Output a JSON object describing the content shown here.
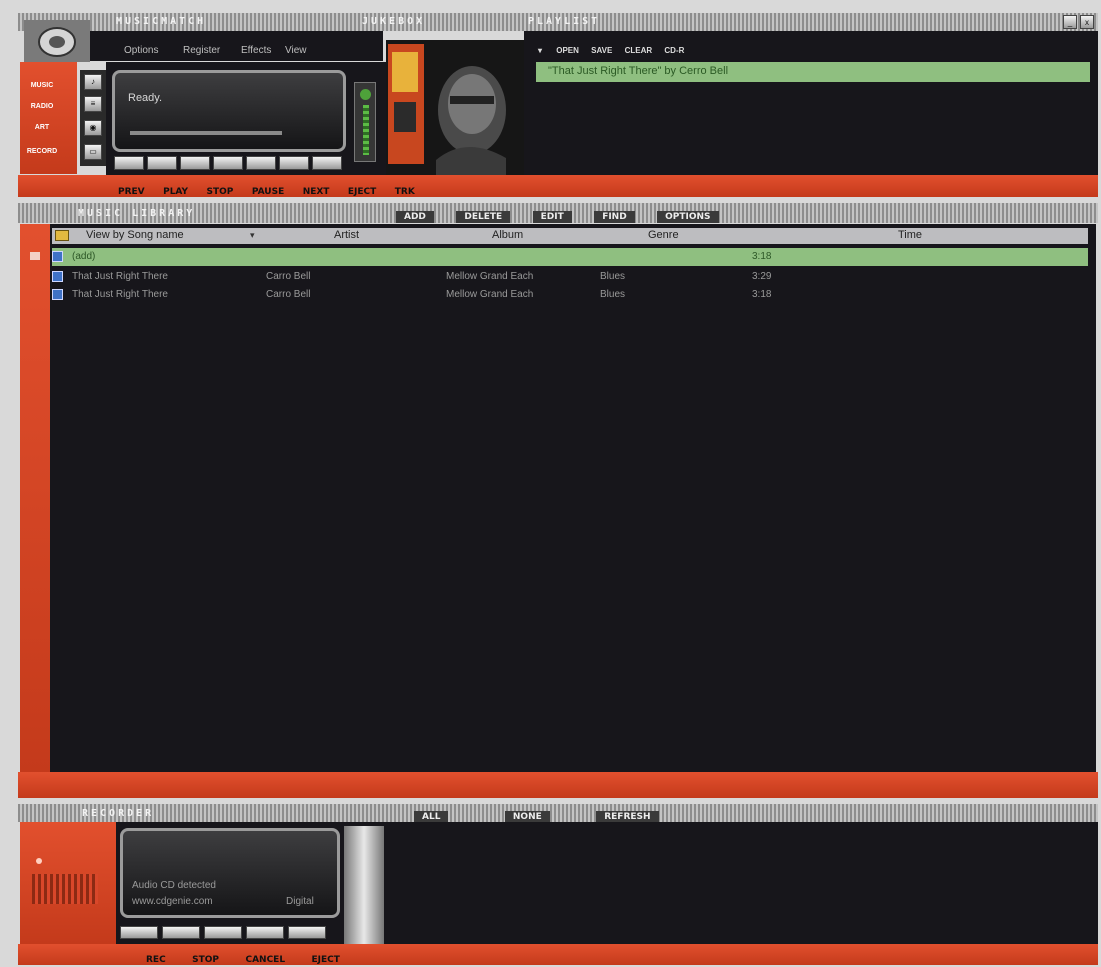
{
  "top": {
    "app_title": "MUSICMATCH",
    "brand_title": "JUKEBOX",
    "playlist_title": "PLAYLIST",
    "menu": [
      "Options",
      "Register",
      "Effects",
      "View"
    ],
    "display_status": "Ready.",
    "left_labels": [
      "MUSIC",
      "RADIO",
      "ART",
      "RECORD"
    ],
    "player_buttons": [
      "",
      "",
      "",
      "",
      "",
      "",
      ""
    ],
    "controls": [
      "PREV",
      "PLAY",
      "STOP",
      "PAUSE",
      "NEXT",
      "EJECT"
    ],
    "extra_control": "TRK",
    "window_buttons": [
      "_",
      "x"
    ]
  },
  "playlist": {
    "toolbar": [
      "OPEN",
      "SAVE",
      "CLEAR",
      "CD-R"
    ],
    "items": [
      "\"That Just Right There\" by Cerro Bell"
    ],
    "selected_index": 0
  },
  "library": {
    "title": "MUSIC LIBRARY",
    "toolbar": [
      "ADD",
      "DELETE",
      "EDIT",
      "FIND",
      "OPTIONS"
    ],
    "columns": [
      "View by Song name",
      "Artist",
      "Album",
      "Genre",
      "Time"
    ],
    "rows": [
      {
        "song": "(add)",
        "artist": "",
        "album": "",
        "genre": "",
        "time": "3:18",
        "highlight": true
      },
      {
        "song": "That Just Right There",
        "artist": "Carro Bell",
        "album": "Mellow Grand Each",
        "genre": "Blues",
        "time": "3:29",
        "highlight": false
      },
      {
        "song": "That Just Right There",
        "artist": "Carro Bell",
        "album": "Mellow Grand Each",
        "genre": "Blues",
        "time": "3:18",
        "highlight": false
      }
    ]
  },
  "recorder": {
    "title": "RECORDER",
    "toolbar": [
      "ALL",
      "NONE",
      "REFRESH"
    ],
    "status_line1": "Audio CD detected",
    "status_line2": "www.cdgenie.com",
    "status_right": "Digital",
    "controls": [
      "REC",
      "STOP",
      "CANCEL",
      "EJECT"
    ]
  },
  "colors": {
    "accent_red": "#d9472a",
    "highlight_green": "#8fbf80",
    "panel_dark": "#17161b",
    "frame_gray": "#9a9a9a"
  }
}
